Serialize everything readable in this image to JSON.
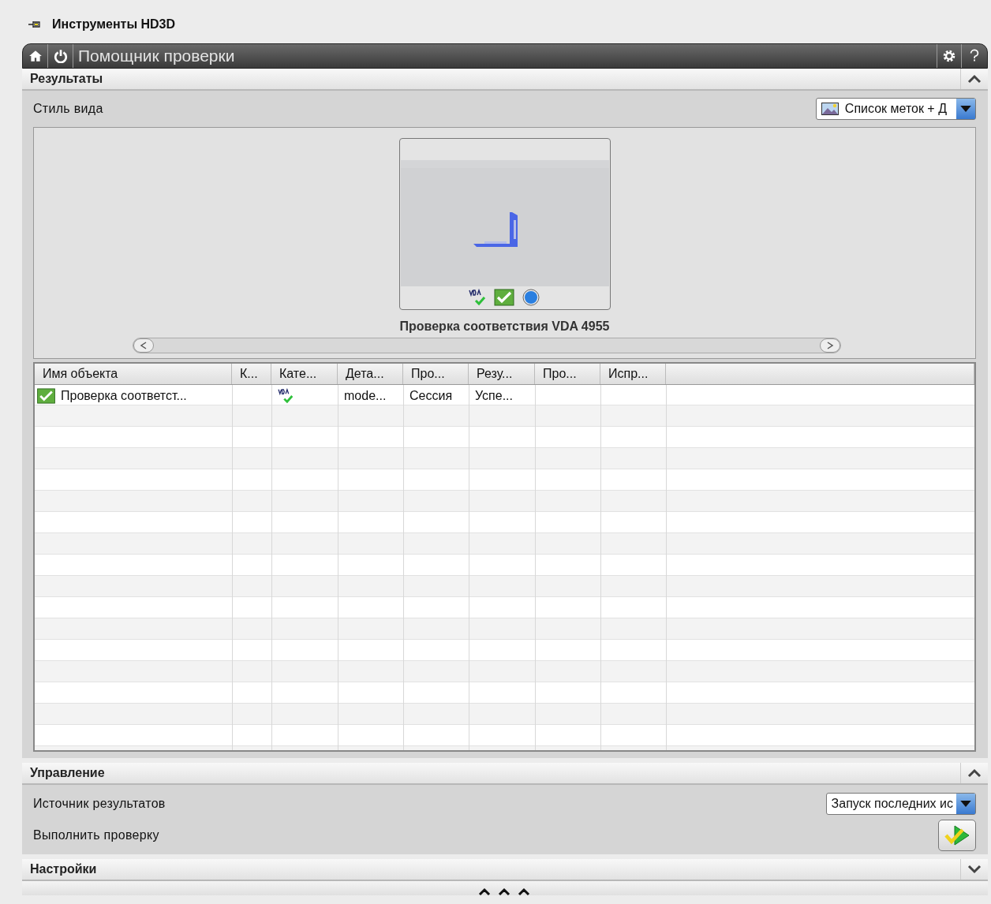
{
  "app_title": "Инструменты HD3D",
  "toolbar": {
    "title": "Помощник проверки"
  },
  "results": {
    "title": "Результаты",
    "expanded": true,
    "view_style": {
      "label": "Стиль вида",
      "value": "Список меток + Д"
    },
    "gallery": [
      {
        "caption": "Проверка соответствия VDA 4955",
        "selected": false
      }
    ],
    "table": {
      "columns": [
        "Имя объекта",
        "К...",
        "Кате...",
        "Дета...",
        "Про...",
        "Резу...",
        "Про...",
        "Испр..."
      ],
      "rows": [
        {
          "cells": [
            "Проверка соответст...",
            null,
            null,
            "mode...",
            "Сессия",
            "Успе...",
            null,
            null
          ]
        }
      ]
    }
  },
  "control": {
    "title": "Управление",
    "expanded": true,
    "source": {
      "label": "Источник результатов",
      "value": "Запуск последних ис"
    },
    "run": {
      "label": "Выполнить проверку"
    }
  },
  "settings": {
    "title": "Настройки",
    "expanded": false
  }
}
